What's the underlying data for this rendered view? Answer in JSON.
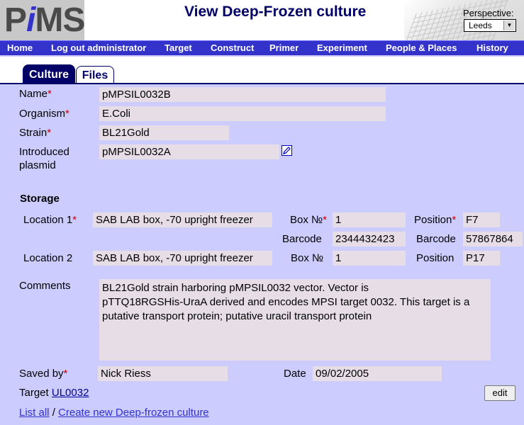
{
  "header": {
    "logo_letters": {
      "p": "P",
      "i": "i",
      "ms": "MS"
    },
    "title": "View Deep-Frozen culture",
    "perspective_label": "Perspective:",
    "perspective_value": "Leeds"
  },
  "nav": [
    {
      "label": "Home"
    },
    {
      "label": "Log out administrator"
    },
    {
      "label": "Target"
    },
    {
      "label": "Construct"
    },
    {
      "label": "Primer"
    },
    {
      "label": "Experiment"
    },
    {
      "label": "People & Places"
    },
    {
      "label": "History"
    }
  ],
  "tabs": {
    "culture": "Culture",
    "files": "Files"
  },
  "form": {
    "name_label": "Name",
    "name_value": "pMPSIL0032B",
    "organism_label": "Organism",
    "organism_value": "E.Coli",
    "strain_label": "Strain",
    "strain_value": "BL21Gold",
    "plasmid_label_1": "Introduced",
    "plasmid_label_2": "plasmid",
    "plasmid_value": "pMPSIL0032A",
    "required_mark": "*"
  },
  "storage": {
    "heading": "Storage",
    "location1_label": "Location 1",
    "location1_value": "SAB LAB box, -70 upright freezer",
    "box_label": "Box №",
    "box1_value": "1",
    "position_label": "Position",
    "position1_value": "F7",
    "barcode_label": "Barcode",
    "box_barcode_value": "2344432423",
    "position_barcode_value": "57867864",
    "location2_label": "Location 2",
    "location2_value": "SAB LAB box, -70 upright freezer",
    "box2_value": "1",
    "position2_value": "P17"
  },
  "comments": {
    "label": "Comments",
    "lines": [
      "BL21Gold strain harboring pMPSIL0032 vector. Vector is",
      "pTTQ18RGSHis-UraA derived and  encodes MPSI target 0032. This target is a",
      "putative transport protein; putative uracil transport protein"
    ]
  },
  "footer": {
    "saved_by_label": "Saved by",
    "saved_by_value": "Nick Riess",
    "date_label": "Date",
    "date_value": "09/02/2005",
    "target_label": "Target",
    "target_link": "UL0032",
    "edit_label": "edit",
    "list_all": "List all",
    "separator": "/",
    "create_new": "Create new Deep-frozen culture"
  },
  "colors": {
    "background": "#ccccff",
    "nav_bar": "#3333cc",
    "title": "#000066",
    "field_bg": "#e6dde6",
    "required": "#cc0000"
  },
  "icons": [
    "edit-plasmid-icon",
    "dropdown-arrow-icon"
  ]
}
